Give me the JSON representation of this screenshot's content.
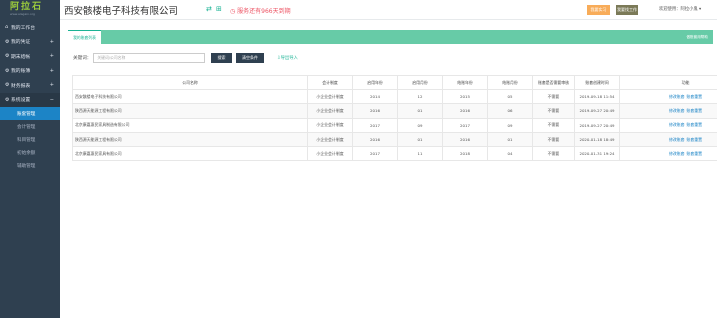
{
  "logo": {
    "main": "阿拉石",
    "sub": "www.alagain.org"
  },
  "sidebar": {
    "items": [
      {
        "label": "我的工作台",
        "icon": "home-icon"
      },
      {
        "label": "我的凭证",
        "icon": "gears-icon"
      },
      {
        "label": "期末结帐",
        "icon": "gears-icon"
      },
      {
        "label": "我的账簿",
        "icon": "gears-icon"
      },
      {
        "label": "财务报表",
        "icon": "gears-icon"
      },
      {
        "label": "系统设置",
        "icon": "gears-icon"
      }
    ],
    "sub_items": [
      "账套管理",
      "会计管理",
      "科目管理",
      "初始余额",
      "辅助管理"
    ]
  },
  "topbar": {
    "company": "西安骸楼电子科技有限公司",
    "warning": "服务还有966天到期",
    "help_label": "我要实习",
    "work_label": "我要找工作",
    "welcome": "欢迎使用：阿拉小鬼 ▾"
  },
  "panel": {
    "tab_label": "我的账套列表",
    "right_label": "做账套用帮助"
  },
  "search": {
    "label": "关键词：",
    "placeholder": "关键词/公司名称",
    "search_label": "搜索",
    "clear_label": "清空条件",
    "import_label": "导出导入"
  },
  "table": {
    "headers": [
      "公司名称",
      "会计制度",
      "启用年份",
      "启用月份",
      "结账年份",
      "结账月份",
      "账套是否需要审核",
      "账套创建时间",
      "功能"
    ],
    "rows": [
      {
        "name": "西安骸楼电子科技有限公司",
        "system": "小企业会计制度",
        "start_year": "2014",
        "start_month": "12",
        "close_year": "2015",
        "close_month": "05",
        "audit": "不需要",
        "created": "2019-09-18 11:54",
        "act1": "修改账套",
        "act2": "账套重置"
      },
      {
        "name": "陕西源天能源工程有限公司",
        "system": "小企业会计制度",
        "start_year": "2016",
        "start_month": "01",
        "close_year": "2016",
        "close_month": "06",
        "audit": "不需要",
        "created": "2019-09-27 20:49",
        "act1": "修改账套",
        "act2": "账套重置"
      },
      {
        "name": "北京康嘉惠民家具制造有限公司",
        "system": "小企业会计制度",
        "start_year": "2017",
        "start_month": "09",
        "close_year": "2017",
        "close_month": "09",
        "audit": "不需要",
        "created": "2019-09-27 20:49",
        "act1": "修改账套",
        "act2": "账套重置"
      },
      {
        "name": "陕西源天能源工程有限公司",
        "system": "小企业会计制度",
        "start_year": "2016",
        "start_month": "01",
        "close_year": "2016",
        "close_month": "01",
        "audit": "不需要",
        "created": "2020-01-18 18:49",
        "act1": "修改账套",
        "act2": "账套重置"
      },
      {
        "name": "北京康嘉惠民家具有限公司",
        "system": "小企业会计制度",
        "start_year": "2017",
        "start_month": "11",
        "close_year": "2018",
        "close_month": "04",
        "audit": "不需要",
        "created": "2020-01-31 19:24",
        "act1": "修改账套",
        "act2": "账套重置"
      }
    ]
  },
  "colors": {
    "sidebar_bg": "#2f4050",
    "accent_green": "#1ab394",
    "tab_bar": "#67cba7",
    "warning_red": "#ed5565",
    "link_blue": "#1c84c6",
    "help_orange": "#f8ac59"
  }
}
